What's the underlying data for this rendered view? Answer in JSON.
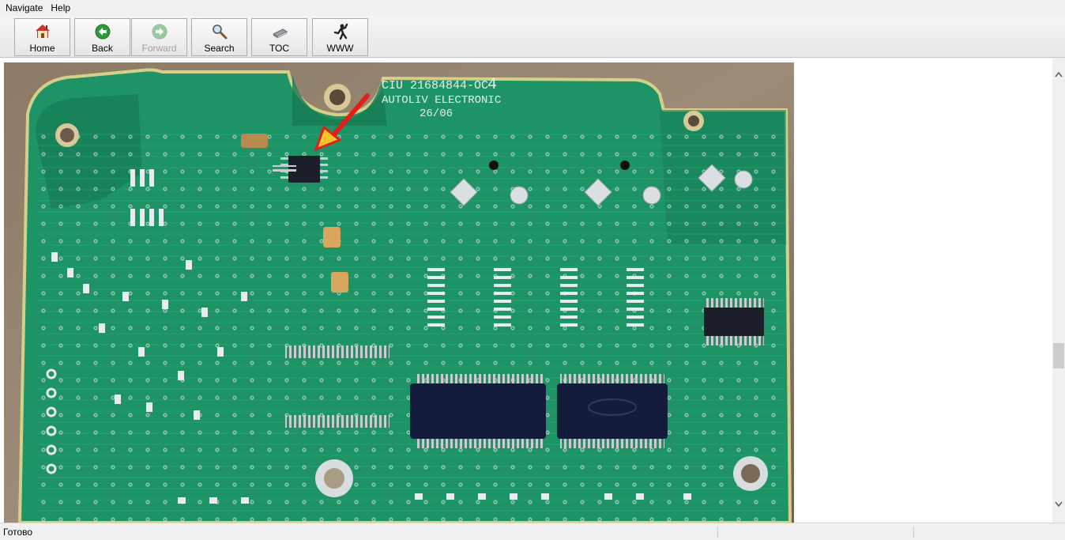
{
  "menu": {
    "items": [
      {
        "label": "Navigate"
      },
      {
        "label": "Help"
      }
    ]
  },
  "toolbar": {
    "home_label": "Home",
    "back_label": "Back",
    "forward_label": "Forward",
    "search_label": "Search",
    "toc_label": "TOC",
    "www_label": "WWW"
  },
  "content": {
    "image_subject": "circuit-board-photo",
    "board_label_line1": "CIU 21684844-OC",
    "board_label_digit": "4",
    "board_label_line2": "AUTOLIV ELECTRONIC",
    "board_label_line3": "26/06"
  },
  "status": {
    "text": "Готово"
  },
  "colors": {
    "pcb_green": "#1f9a6a",
    "pcb_dark": "#13704c",
    "arrow_red": "#e0201a",
    "chip_black": "#1b1f2a",
    "chip_navy": "#131c3a"
  }
}
